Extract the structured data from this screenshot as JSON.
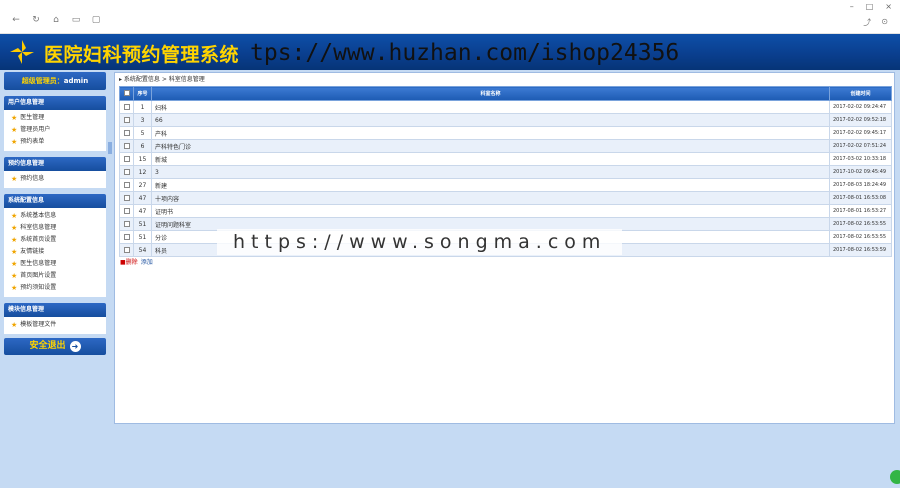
{
  "browser": {
    "nav_icons": [
      "←",
      "↻",
      "⌂",
      "▭",
      "▢"
    ],
    "window_icons": [
      "–",
      "□",
      "×"
    ],
    "right_icons": [
      "⤴",
      "⊙"
    ]
  },
  "app": {
    "title": "医院妇科预约管理系统",
    "watermark_top": "tps://www.huzhan.com/ishop24356",
    "watermark_mid": "https://www.songma.com",
    "accent_color": "#0a3f8f",
    "title_color": "#ffd400"
  },
  "sidebar": {
    "admin_label": "超级管理员：",
    "admin_name": "admin",
    "groups": [
      {
        "title": "用户信息管理",
        "items": [
          "医生管理",
          "管理员用户",
          "预约表单"
        ]
      },
      {
        "title": "预约信息管理",
        "items": [
          "预约信息"
        ]
      },
      {
        "title": "系统配置信息",
        "items": [
          "系统基本信息",
          "科室信息管理",
          "系统首页设置",
          "友情链接",
          "医生信息管理",
          "首页图片设置",
          "预约须知设置"
        ]
      },
      {
        "title": "模块信息管理",
        "items": [
          "模板管理文件"
        ]
      }
    ],
    "logout_label": "安全退出",
    "logout_icon": "arrow-right-icon"
  },
  "main": {
    "breadcrumb": [
      "系统配置信息",
      "科室信息管理"
    ],
    "columns": [
      "",
      "序号",
      "科室名称",
      "创建时间"
    ],
    "rows": [
      {
        "id": "1",
        "name": "妇科",
        "date": "2017-02-02 09:24:47"
      },
      {
        "id": "3",
        "name": "66",
        "date": "2017-02-02 09:52:18"
      },
      {
        "id": "5",
        "name": "产科",
        "date": "2017-02-02 09:45:17"
      },
      {
        "id": "6",
        "name": "产科特色门诊",
        "date": "2017-02-02 07:51:24"
      },
      {
        "id": "15",
        "name": "新城",
        "date": "2017-03-02 10:33:18"
      },
      {
        "id": "12",
        "name": "3",
        "date": "2017-10-02 09:45:49"
      },
      {
        "id": "27",
        "name": "新建",
        "date": "2017-08-03 18:24:49"
      },
      {
        "id": "47",
        "name": "十项内容",
        "date": "2017-08-01 16:53:08"
      },
      {
        "id": "47",
        "name": "证明书",
        "date": "2017-08-01 16:53:27"
      },
      {
        "id": "51",
        "name": "证明问题科室",
        "date": "2017-08-02 16:53:55"
      },
      {
        "id": "51",
        "name": "分诊",
        "date": "2017-08-02 16:53:55"
      },
      {
        "id": "54",
        "name": "科员",
        "date": "2017-08-02 16:53:59"
      }
    ],
    "delete_label": "删除",
    "add_label": "添加"
  }
}
